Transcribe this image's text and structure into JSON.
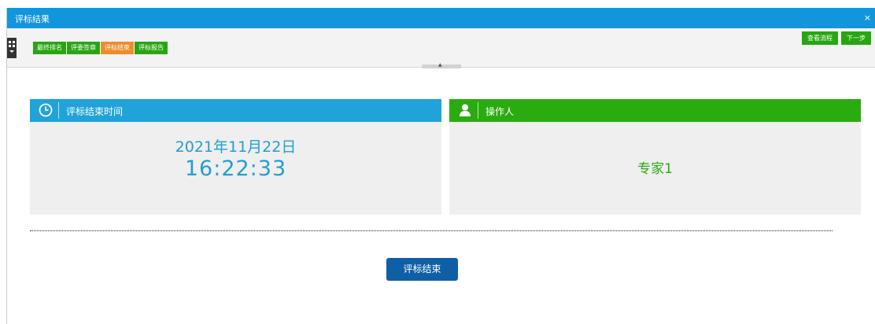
{
  "window": {
    "title": "评标结果",
    "close_label": "×"
  },
  "steps": [
    {
      "label": "最终排名"
    },
    {
      "label": "评委签章"
    },
    {
      "label": "评标结束"
    },
    {
      "label": "评标报告"
    }
  ],
  "active_step_index": 2,
  "toolbar": {
    "view_process_label": "查看流程",
    "next_label": "下一步",
    "collapse_glyph": "▲"
  },
  "time_panel": {
    "title": "评标结束时间",
    "date": "2021年11月22日",
    "time": "16:22:33"
  },
  "operator_panel": {
    "title": "操作人",
    "name": "专家1"
  },
  "end_button_label": "评标结束",
  "colors": {
    "title_blue": "#1296db",
    "green": "#29a513",
    "orange": "#f08b2c",
    "button_blue": "#0f5fa6"
  }
}
